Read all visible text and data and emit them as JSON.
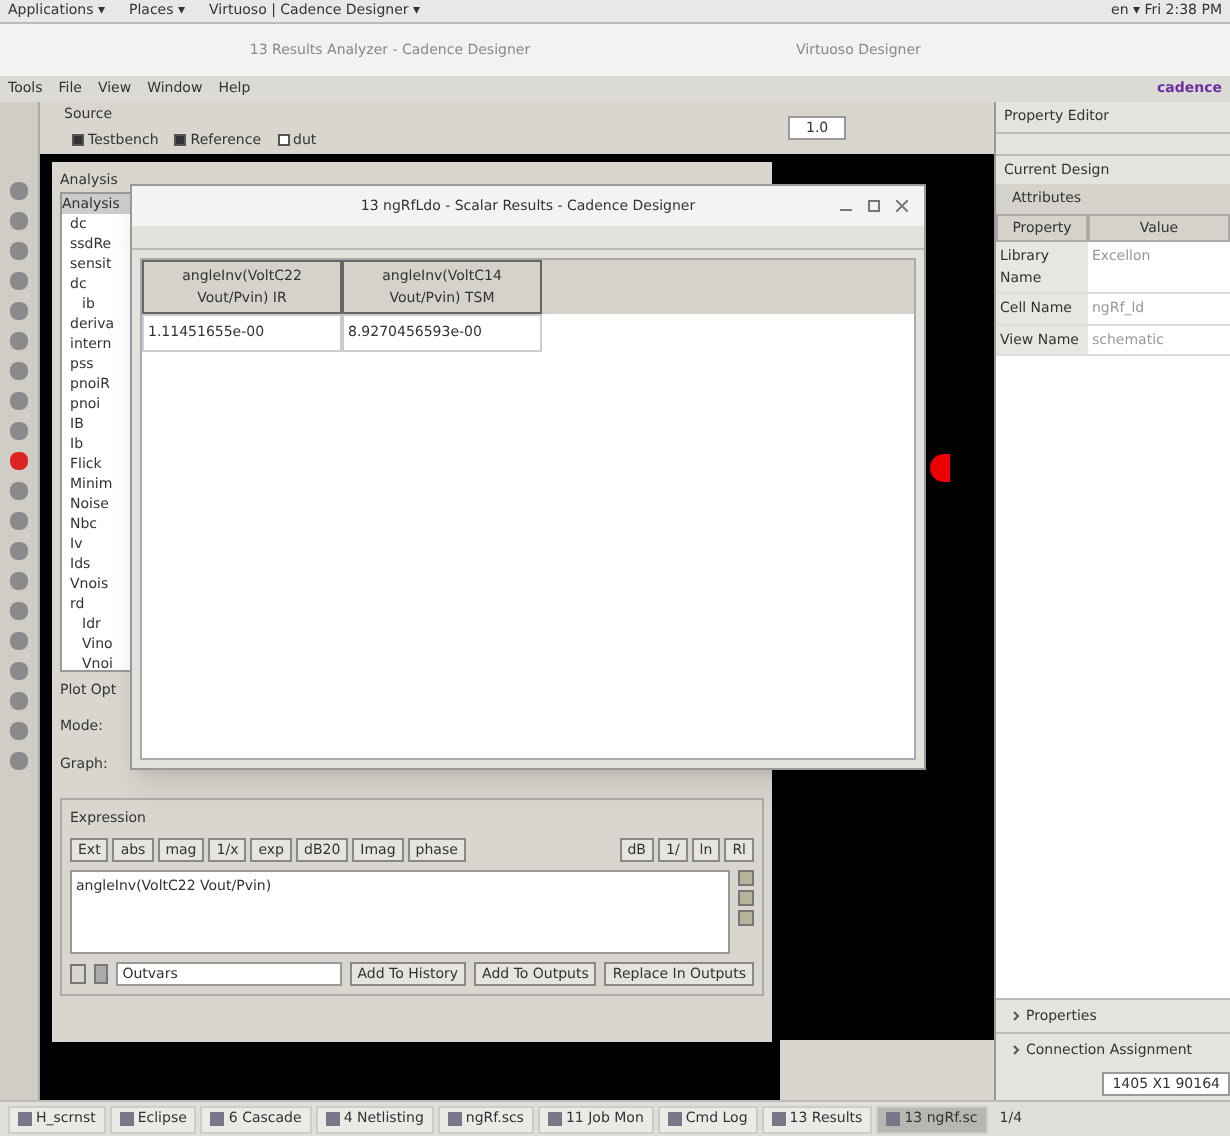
{
  "top_panel": {
    "menus": [
      "Applications ▾",
      "Places ▾",
      "Virtuoso | Cadence Designer ▾"
    ],
    "clock": "en ▾  Fri 2:38 PM"
  },
  "main_window": {
    "title": "13 Results Analyzer - Cadence Designer",
    "second_title": "Virtuoso Designer",
    "menu": [
      "Tools",
      "File",
      "View",
      "Window",
      "Help"
    ],
    "brand": "cadence"
  },
  "source": {
    "label": "Source",
    "options": [
      {
        "label": "Testbench",
        "checked": true
      },
      {
        "label": "Reference",
        "checked": true
      },
      {
        "label": "dut",
        "checked": false
      }
    ],
    "zoom": "1.0"
  },
  "analysis": {
    "title": "Analysis",
    "header": "Analysis",
    "items": [
      {
        "label": "dc"
      },
      {
        "label": "ssdRe"
      },
      {
        "label": "sensit"
      },
      {
        "label": "dc",
        "children": [
          {
            "label": "ib"
          }
        ]
      },
      {
        "label": "deriva"
      },
      {
        "label": "intern"
      },
      {
        "label": "pss"
      },
      {
        "label": "pnoiR"
      },
      {
        "label": "pnoi"
      },
      {
        "label": "IB"
      },
      {
        "label": "Ib"
      },
      {
        "label": "Flick"
      },
      {
        "label": "Minim"
      },
      {
        "label": "Noise"
      },
      {
        "label": "Nbc"
      },
      {
        "label": "Iv"
      },
      {
        "label": "Ids"
      },
      {
        "label": "Vnois"
      },
      {
        "label": "rd",
        "children": [
          {
            "label": "Idr"
          },
          {
            "label": "Vino"
          },
          {
            "label": "Vnoi"
          }
        ]
      }
    ],
    "plot_options": "Plot Opt",
    "mode": "Mode:",
    "graph": "Graph:"
  },
  "expression": {
    "title": "Expression",
    "buttons": [
      "Ext",
      "abs",
      "mag",
      "1/x",
      "exp",
      "dB20",
      "Imag",
      "phase"
    ],
    "right_buttons": [
      "dB",
      "1/",
      "ln",
      "Rl"
    ],
    "text": "angleInv(VoltC22 Vout/Pvin)",
    "field": "Outvars",
    "actions": [
      "Add To History",
      "Add To Outputs",
      "Replace In Outputs"
    ]
  },
  "dialog": {
    "title": "13 ngRfLdo - Scalar Results - Cadence Designer",
    "columns": [
      "angleInv(VoltC22 Vout/Pvin) IR",
      "angleInv(VoltC14 Vout/Pvin) TSM"
    ],
    "rows": [
      [
        "1.11451655e-00",
        "8.9270456593e-00"
      ]
    ]
  },
  "property_editor": {
    "title": "Property Editor",
    "current": "Current Design",
    "section": "Attributes",
    "columns": [
      "Property",
      "Value"
    ],
    "rows": [
      [
        "Library Name",
        "Excellon"
      ],
      [
        "Cell Name",
        "ngRf_ld"
      ],
      [
        "View Name",
        "schematic"
      ]
    ],
    "footer": [
      "Properties",
      "Connection Assignment"
    ],
    "status": "1405 X1 90164"
  },
  "taskbar": [
    {
      "label": "H_scrnst",
      "selected": false
    },
    {
      "label": "Eclipse",
      "selected": false
    },
    {
      "label": "6 Cascade",
      "selected": false
    },
    {
      "label": "4 Netlisting",
      "selected": false
    },
    {
      "label": "ngRf.scs",
      "selected": false
    },
    {
      "label": "11 Job Mon",
      "selected": false
    },
    {
      "label": "Cmd Log",
      "selected": false
    },
    {
      "label": "13 Results",
      "selected": false
    },
    {
      "label": "13 ngRf.sc",
      "selected": true
    }
  ],
  "workspace": "1/4"
}
